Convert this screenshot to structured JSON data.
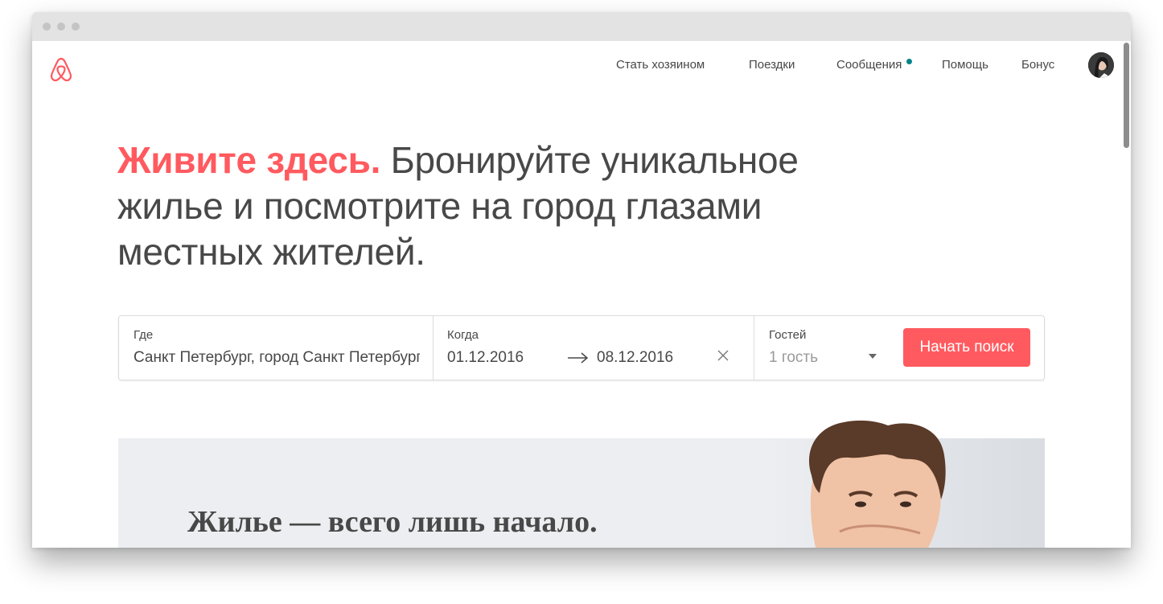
{
  "nav": {
    "become_host": "Стать хозяином",
    "trips": "Поездки",
    "messages": "Сообщения",
    "help": "Помощь",
    "bonus": "Бонус"
  },
  "hero": {
    "highlight": "Живите здесь.",
    "text": "Бронируйте уникальное жилье и посмотрите на город глазами местных жителей."
  },
  "search": {
    "where_label": "Где",
    "where_value": "Санкт Петербург, город Санкт Петербург",
    "when_label": "Когда",
    "checkin": "01.12.2016",
    "checkout": "08.12.2016",
    "guests_label": "Гостей",
    "guests_value": "1 гость",
    "button": "Начать поиск"
  },
  "banner": {
    "title": "Жилье — всего лишь начало."
  },
  "colors": {
    "brand": "#ff5a5f",
    "notification": "#008489",
    "text": "#484848"
  },
  "icons": [
    "airbnb-logo-icon",
    "notification-dot-icon",
    "arrow-right-icon",
    "clear-x-icon",
    "caret-down-icon"
  ]
}
